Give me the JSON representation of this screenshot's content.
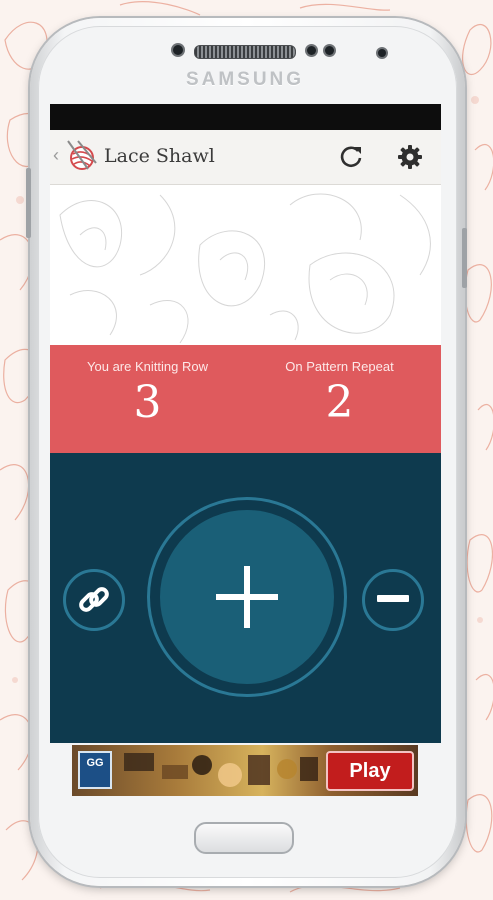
{
  "device": {
    "brand": "SAMSUNG"
  },
  "app": {
    "title": "Lace Shawl",
    "back_icon": "chevron-left-icon",
    "logo_icon": "yarn-ball-needles-icon",
    "refresh_icon": "refresh-icon",
    "settings_icon": "gear-icon"
  },
  "counters": {
    "row_label": "You are Knitting Row",
    "row_value": "3",
    "repeat_label": "On Pattern Repeat",
    "repeat_value": "2"
  },
  "controls": {
    "link_icon": "link-icon",
    "increment_icon": "plus-icon",
    "decrement_icon": "minus-icon"
  },
  "ad": {
    "logo_text": "GG",
    "play_label": "Play"
  },
  "colors": {
    "accent_red": "#df5a5d",
    "dark_teal": "#0e3a4e",
    "button_teal": "#1a5f77",
    "ring_teal": "#2a7895"
  }
}
